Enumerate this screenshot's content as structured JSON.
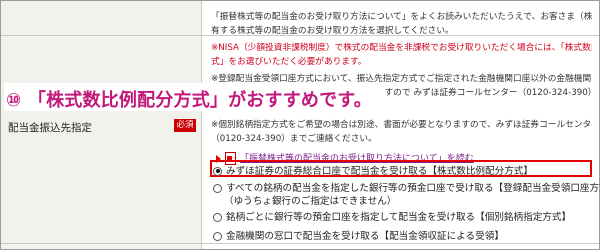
{
  "row": {
    "label": "配当金振込先指定",
    "badge": "必須"
  },
  "notes": {
    "p1": [
      "「振替株式等の配当金のお受け取り方法について」をよくお読みいただいたうえで、お客さま（株主）が当社に保",
      "有する株式等の配当金のお受け取り方法を選択してください。"
    ],
    "p2": [
      "※NISA（少額投資非課税制度）で株式の配当金を非課税でお受け取りいただく場合には、「株式数比例配分方",
      "式」をお選びいただく必要があります。"
    ],
    "p3": [
      "※登録配当金受領口座方式において、振込先指定方式でご指定された金融機関口座以外の金融機関口座を",
      "ご希望の場合は、別途、書面が必要となりますので みずほ証券コールセンター（0120-324-390）までご連絡ください。"
    ],
    "p4": [
      "※個別銘柄指定方式をご希望の場合は別途、書面が必要となりますので、みずほ証券コールセンター",
      "（0120-324-390）までご連絡ください。"
    ]
  },
  "link": {
    "text": "「振替株式等の配当金のお受け取り方法について」を読む"
  },
  "options": [
    {
      "label": "みずほ証券の証券総合口座で配当金を受け取る【株式数比例配分方式】",
      "selected": true
    },
    {
      "label": "すべての銘柄の配当金を指定した銀行等の預金口座で受け取る【登録配当金受領口座方式】",
      "selected": false
    },
    {
      "label": "（ゆうちょ銀行のご指定はできません）",
      "selected": false
    },
    {
      "label": "銘柄ごとに銀行等の預金口座を指定して配当金を受け取る【個別銘柄指定方式】",
      "selected": false
    },
    {
      "label": "金融機関の窓口で配当金を受け取る【配当金領収証による受領】",
      "selected": false
    }
  ],
  "overlay": {
    "text": "⑩ 「株式数比例配分方式」がおすすめです。"
  },
  "colors": {
    "accent": "#e60000",
    "overlay": "#c2187a"
  }
}
